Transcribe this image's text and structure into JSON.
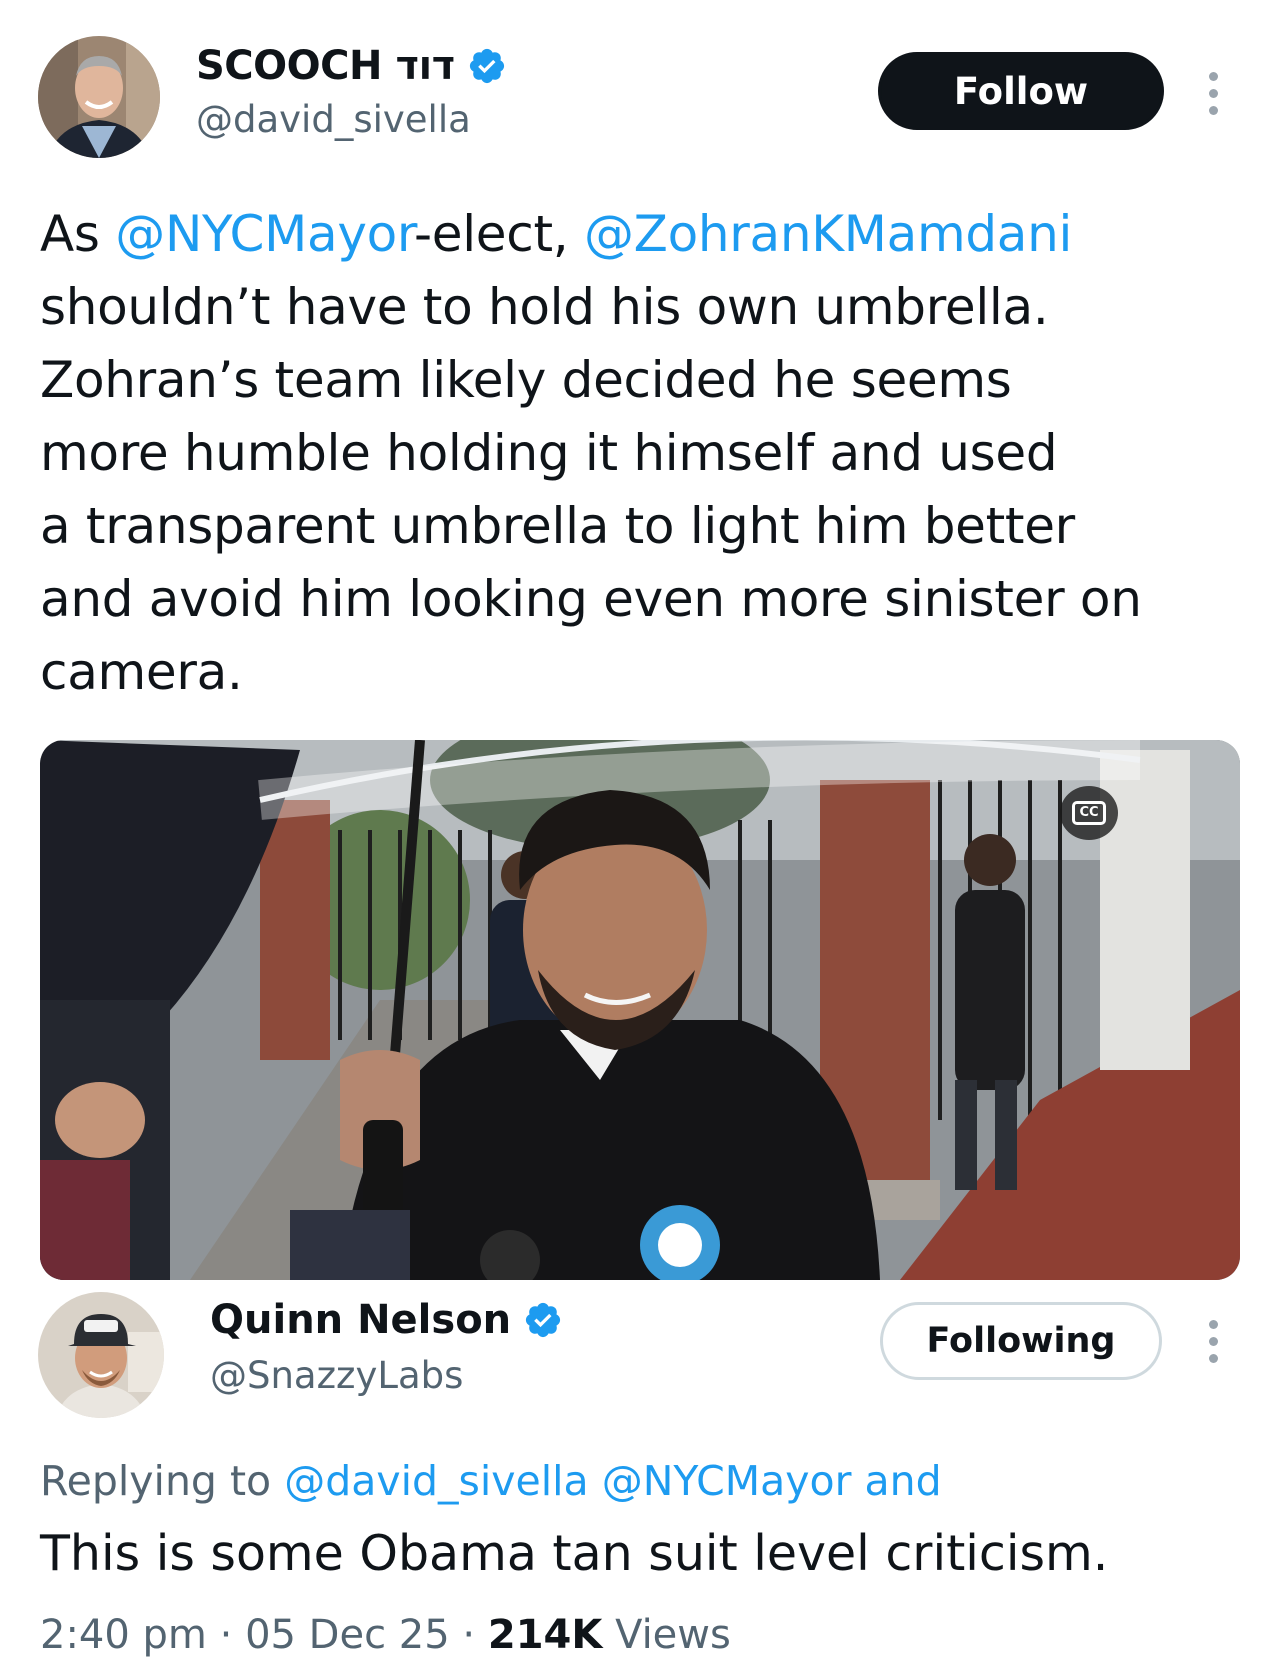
{
  "tweet": {
    "author": {
      "display_name": "SCOOCH דוד",
      "handle": "@david_sivella",
      "verified": true
    },
    "follow_label": "Follow",
    "text_lines": [
      [
        {
          "text": "As ",
          "mention": false
        },
        {
          "text": "@NYCMayor",
          "mention": true
        },
        {
          "text": "-elect, ",
          "mention": false
        },
        {
          "text": "@ZohranKMamdani",
          "mention": true
        }
      ],
      [
        {
          "text": "shouldn’t have to hold his own umbrella.",
          "mention": false
        }
      ],
      [
        {
          "text": "Zohran’s team likely decided he seems",
          "mention": false
        }
      ],
      [
        {
          "text": "more humble holding it himself and used",
          "mention": false
        }
      ],
      [
        {
          "text": "a transparent umbrella to light him better",
          "mention": false
        }
      ],
      [
        {
          "text": "and avoid him looking even more sinister on",
          "mention": false
        }
      ],
      [
        {
          "text": "camera.",
          "mention": false
        }
      ]
    ],
    "media": {
      "caption_badge": "CC"
    }
  },
  "reply": {
    "author": {
      "display_name": "Quinn Nelson",
      "handle": "@SnazzyLabs",
      "verified": true
    },
    "following_label": "Following",
    "replying_prefix": "Replying to ",
    "replying_mentions": "@david_sivella @NYCMayor and",
    "text": "This is some Obama tan suit level criticism.",
    "time": "2:40 pm",
    "separator": "·",
    "date": "05 Dec 25",
    "views_count": "214K",
    "views_label": "Views"
  },
  "colors": {
    "accent": "#1d9bf0",
    "text": "#0f1419",
    "secondary": "#536471",
    "follow_bg": "#0f1419"
  }
}
